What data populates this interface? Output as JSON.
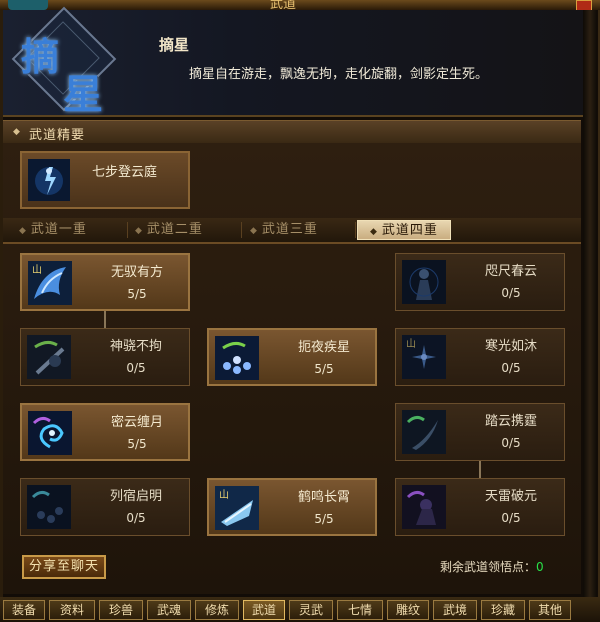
{
  "window_title": "武道",
  "header": {
    "emblem_char_1": "摘",
    "emblem_char_2": "星",
    "skill_name": "摘星",
    "skill_desc": "摘星自在游走，飘逸无拘，走化旋翻，剑影定生死。"
  },
  "essence_section": {
    "label": "武道精要",
    "item": {
      "name": "七步登云庭",
      "icon": "lightning-figure-icon"
    }
  },
  "tabs": [
    {
      "label": "武道一重",
      "active": false
    },
    {
      "label": "武道二重",
      "active": false
    },
    {
      "label": "武道三重",
      "active": false
    },
    {
      "label": "武道四重",
      "active": true
    }
  ],
  "skills": [
    {
      "name": "无驭有方",
      "points": "5/5",
      "learned": true,
      "icon": "blue-dragon-icon"
    },
    {
      "name": "咫尺春云",
      "points": "0/5",
      "learned": false,
      "icon": "dark-figure-icon"
    },
    {
      "name": "神骁不拘",
      "points": "0/5",
      "learned": false,
      "icon": "sword-slash-icon"
    },
    {
      "name": "扼夜疾星",
      "points": "5/5",
      "learned": true,
      "icon": "blue-orbs-icon"
    },
    {
      "name": "寒光如沐",
      "points": "0/5",
      "learned": false,
      "icon": "star-burst-icon"
    },
    {
      "name": "密云缠月",
      "points": "5/5",
      "learned": true,
      "icon": "purple-swirl-icon"
    },
    {
      "name": "踏云携霆",
      "points": "0/5",
      "learned": false,
      "icon": "wind-blade-icon"
    },
    {
      "name": "列宿启明",
      "points": "0/5",
      "learned": false,
      "icon": "moon-orbs-icon"
    },
    {
      "name": "鹤鸣长霄",
      "points": "5/5",
      "learned": true,
      "icon": "ice-wing-icon"
    },
    {
      "name": "天雷破元",
      "points": "0/5",
      "learned": false,
      "icon": "thunder-figure-icon"
    }
  ],
  "share_button": "分享至聊天",
  "remaining": {
    "label": "剩余武道领悟点：",
    "value": "0"
  },
  "bottom_nav": [
    "装备",
    "资料",
    "珍兽",
    "武魂",
    "修炼",
    "武道",
    "灵武",
    "七情",
    "雕纹",
    "武境",
    "珍藏",
    "其他"
  ],
  "bottom_nav_selected": "武道",
  "colors": {
    "learned_border": "#9a7440",
    "points_value": "#28e048",
    "emblem_blue": "#3a7fd8"
  }
}
